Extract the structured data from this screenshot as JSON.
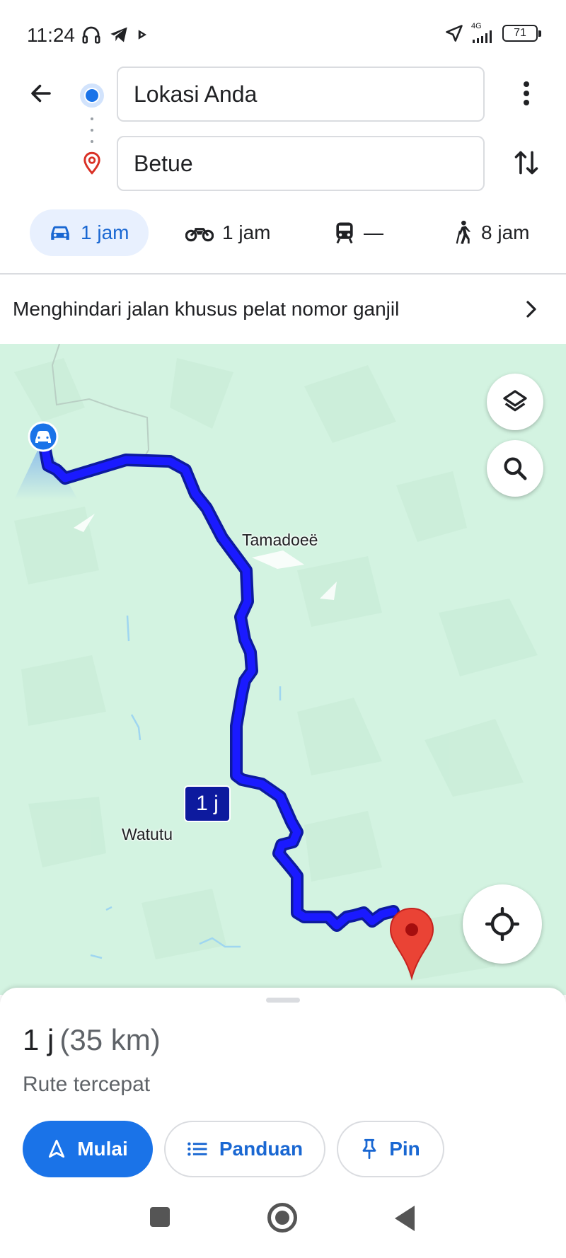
{
  "status_bar": {
    "time": "11:24",
    "network": "4G",
    "battery": "71",
    "icons": [
      "headphones-icon",
      "telegram-icon",
      "play-icon",
      "location-arrow-icon",
      "signal-icon",
      "battery-icon"
    ]
  },
  "directions": {
    "origin": "Lokasi Anda",
    "destination": "Betue"
  },
  "modes": [
    {
      "icon": "car-icon",
      "label": "1 jam",
      "active": true
    },
    {
      "icon": "motorcycle-icon",
      "label": "1 jam",
      "active": false
    },
    {
      "icon": "transit-icon",
      "label": "—",
      "active": false
    },
    {
      "icon": "walk-icon",
      "label": "8 jam",
      "active": false
    }
  ],
  "notice": {
    "text": "Menghindari jalan khusus pelat nomor ganjil"
  },
  "map": {
    "labels": {
      "tamadoee": "Tamadoeë",
      "watutu": "Watutu"
    },
    "duration_tag": "1 j",
    "colors": {
      "land": "#d3f3e1",
      "route": "#1a1aff",
      "route_outline": "#0d1a9e",
      "pin": "#ea4335"
    }
  },
  "trip": {
    "duration": "1 j",
    "distance": "(35 km)",
    "description": "Rute tercepat",
    "start_label": "Mulai",
    "steps_label": "Panduan",
    "pin_label": "Pin"
  },
  "colors": {
    "accent": "#1a73e8",
    "accent_text": "#1967d2",
    "active_tab_bg": "#e8f0fe"
  }
}
